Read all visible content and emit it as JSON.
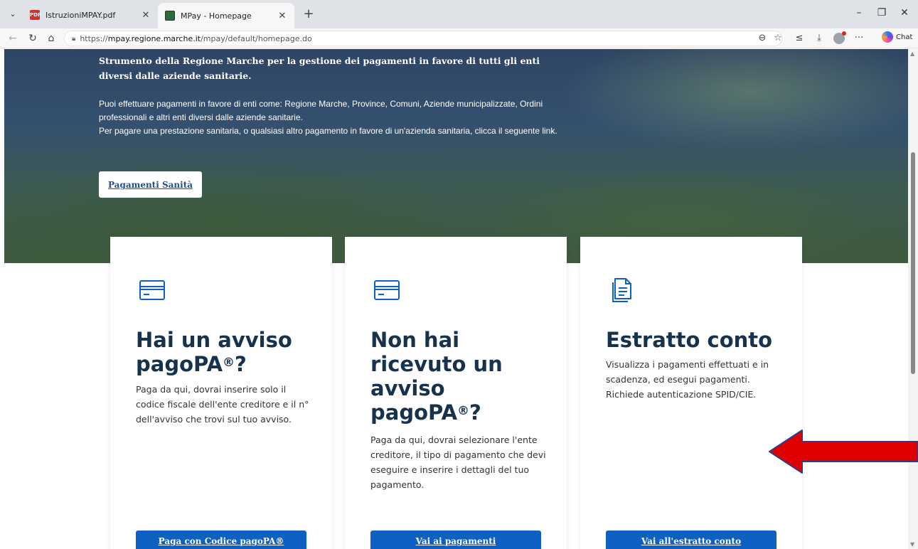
{
  "browser": {
    "tabs": [
      {
        "label": "IstruzioniMPAY.pdf",
        "active": false,
        "icon": "pdf-icon"
      },
      {
        "label": "MPay - Homepage",
        "active": true,
        "icon": "mpay-favicon"
      }
    ],
    "url_scheme": "https://",
    "url_host": "mpay.regione.marche.it",
    "url_path": "/mpay/default/homepage.do",
    "chat_label": "Chat"
  },
  "hero": {
    "title": "Strumento della Regione Marche per la gestione dei pagamenti in favore di tutti gli enti diversi dalle aziende sanitarie.",
    "text1": "Puoi effettuare pagamenti in favore di enti come: Regione Marche, Province, Comuni, Aziende municipalizzate, Ordini professionali e altri enti diversi dalle aziende sanitarie.",
    "text2": "Per pagare una prestazione sanitaria, o qualsiasi altro pagamento in favore di un'azienda sanitaria, clicca il seguente link.",
    "button": "Pagamenti Sanità"
  },
  "cards": [
    {
      "icon": "credit-card-icon",
      "title": "Hai un avviso pagoPA",
      "title_sup": "®",
      "title_end": "?",
      "text": "Paga da qui, dovrai inserire solo il codice fiscale dell'ente creditore e il n° dell'avviso che trovi sul tuo avviso.",
      "button": "Paga con Codice pagoPA®"
    },
    {
      "icon": "credit-card-icon",
      "title": "Non hai ricevuto un avviso pagoPA",
      "title_sup": "®",
      "title_end": "?",
      "text": "Paga da qui, dovrai selezionare l'ente creditore, il tipo di pagamento che devi eseguire e inserire i dettagli del tuo pagamento.",
      "button": "Vai ai pagamenti"
    },
    {
      "icon": "document-icon",
      "title": "Estratto conto",
      "text": "Visualizza i pagamenti effettuati e in scadenza, ed esegui pagamenti. Richiede autenticazione SPID/CIE.",
      "button": "Vai all'estratto conto"
    }
  ],
  "colors": {
    "primary": "#0e61c2",
    "heading": "#17324d",
    "annotation_arrow": "#e00000"
  }
}
